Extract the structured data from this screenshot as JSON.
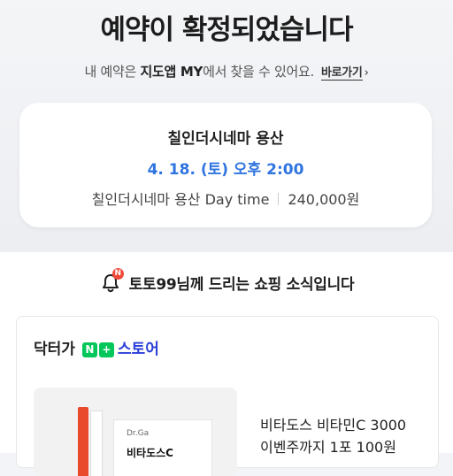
{
  "header": {
    "headline": "예약이 확정되었습니다",
    "sub_prefix": "내 예약은 ",
    "sub_bold": "지도앱 MY",
    "sub_suffix": "에서 찾을 수 있어요.",
    "link_label": "바로가기"
  },
  "reservation": {
    "venue": "칠인더시네마 용산",
    "datetime": "4. 18. (토) 오후 2:00",
    "product": "칠인더시네마 용산 Day time",
    "price": "240,000원"
  },
  "notice": {
    "badge": "N",
    "text": "토토99님께 드리는 쇼핑 소식입니다"
  },
  "store": {
    "name": "닥터가",
    "badge1": "N",
    "badge2": "+",
    "suffix": "스토어",
    "product_lines": [
      "비타도스 비타민C 3000",
      "이벤주까지 1포 100원"
    ],
    "thumb_brand": "Dr.Ga",
    "thumb_label": "비타도스C"
  },
  "colors": {
    "accent_blue": "#2f74e0",
    "naver_green": "#03c75a",
    "badge_red": "#f04a3a"
  }
}
